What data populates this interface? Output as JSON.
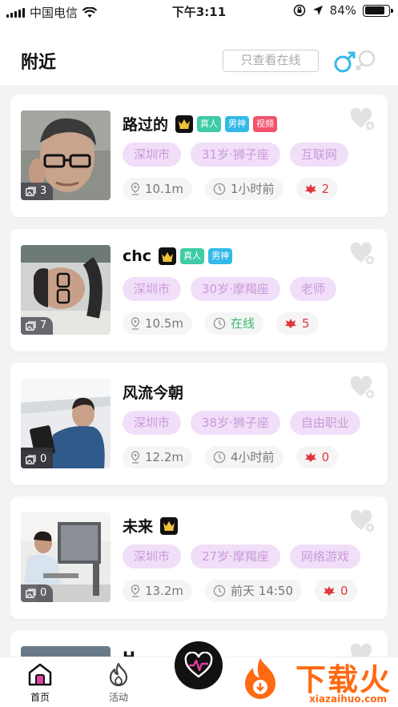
{
  "status": {
    "carrier": "中国电信",
    "time": "下午3:11",
    "battery": "84%"
  },
  "header": {
    "title": "附近",
    "online_filter": "只查看在线"
  },
  "cards": [
    {
      "name": "路过的",
      "vip": true,
      "badges": [
        "真人",
        "男神",
        "视频"
      ],
      "photo_count": "3",
      "tags": [
        "深圳市",
        "31岁·狮子座",
        "互联网"
      ],
      "distance": "10.1m",
      "time": "1小时前",
      "flowers": "2"
    },
    {
      "name": "chc",
      "vip": true,
      "badges": [
        "真人",
        "男神"
      ],
      "photo_count": "7",
      "tags": [
        "深圳市",
        "30岁·摩羯座",
        "老师"
      ],
      "distance": "10.5m",
      "time": "在线",
      "flowers": "5"
    },
    {
      "name": "风流今朝",
      "vip": false,
      "badges": [],
      "photo_count": "0",
      "tags": [
        "深圳市",
        "38岁·狮子座",
        "自由职业"
      ],
      "distance": "12.2m",
      "time": "4小时前",
      "flowers": "0"
    },
    {
      "name": "未来",
      "vip": true,
      "badges": [],
      "photo_count": "0",
      "tags": [
        "深圳市",
        "27岁·摩羯座",
        "网络游戏"
      ],
      "distance": "13.2m",
      "time": "前天 14:50",
      "flowers": "0"
    },
    {
      "name": "H"
    }
  ],
  "tabbar": {
    "home": "首页",
    "activity": "活动"
  },
  "watermark": {
    "text": "下载火",
    "url": "xiazaihuo.com"
  },
  "colors": {
    "tag_bg": "#f1def8",
    "tag_text": "#c99ad9",
    "online": "#35b86a",
    "flower": "#e0353d",
    "badge_real": "#3ecba5",
    "badge_god": "#33b9e8",
    "badge_video": "#f2526b",
    "male_icon": "#33b9e8"
  }
}
